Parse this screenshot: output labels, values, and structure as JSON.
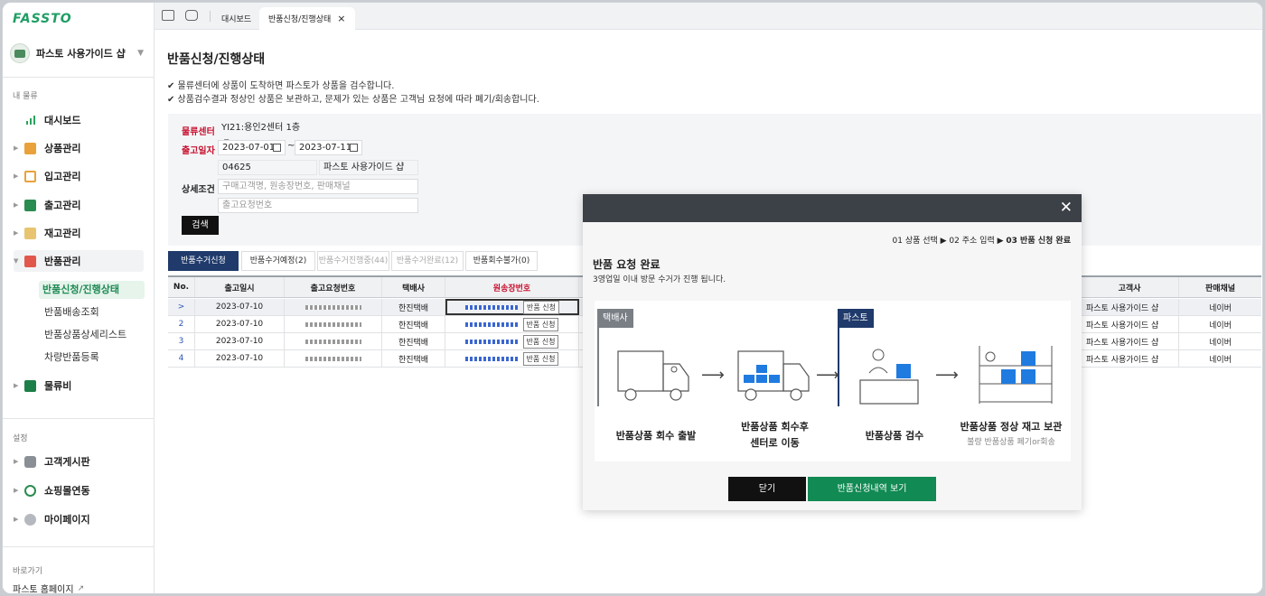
{
  "brand": {
    "logo": "FASSTO"
  },
  "shop": {
    "name": "파스토 사용가이드 샵"
  },
  "sidebar": {
    "group_my": "내 물류",
    "items": [
      {
        "label": "대시보드"
      },
      {
        "label": "상품관리"
      },
      {
        "label": "입고관리"
      },
      {
        "label": "출고관리"
      },
      {
        "label": "재고관리"
      },
      {
        "label": "반품관리"
      },
      {
        "label": "물류비"
      }
    ],
    "sub_items": [
      {
        "label": "반품신청/진행상태"
      },
      {
        "label": "반품배송조회"
      },
      {
        "label": "반품상품상세리스트"
      },
      {
        "label": "차량반품등록"
      }
    ],
    "group_settings": "설정",
    "settings_items": [
      {
        "label": "고객게시판"
      },
      {
        "label": "쇼핑몰연동"
      },
      {
        "label": "마이페이지"
      }
    ],
    "group_shortcuts": "바로가기",
    "shortcut_home": "파스토 홈페이지"
  },
  "tabs": [
    {
      "label": "대시보드"
    },
    {
      "label": "반품신청/진행상태",
      "close": "×"
    }
  ],
  "page": {
    "title": "반품신청/진행상태",
    "note1": "✔ 물류센터에 상품이 도착하면 파스토가 상품을 검수합니다.",
    "note2": "✔ 상품검수결과 정상인 상품은 보관하고, 문제가 있는 상품은 고객님 요청에 따라 폐기/회송합니다."
  },
  "filters": {
    "center_label": "물류센터",
    "center_value": "YI21:용인2센터 1층",
    "date_label": "출고일자",
    "date_from": "2023-07-01",
    "date_sep": "~",
    "date_to": "2023-07-11",
    "shop_code": "04625",
    "shop_name": "파스토 사용가이드 샵",
    "detail_label": "상세조건",
    "detail_placeholder": "구매고객명, 원송장번호, 판매채널",
    "order_placeholder": "출고요청번호",
    "search_label": "검색"
  },
  "grid_tabs": [
    {
      "label": "반품수거신청"
    },
    {
      "label": "반품수거예정(2)"
    },
    {
      "label": "반품수거진행중(44)"
    },
    {
      "label": "반품수거완료(12)"
    },
    {
      "label": "반품회수불가(0)"
    }
  ],
  "table": {
    "headers": {
      "no": "No.",
      "date": "출고일시",
      "order": "출고요청번호",
      "courier": "택배사",
      "invoice": "원송장번호",
      "customer": "고객사",
      "channel": "판매채널"
    },
    "rows": [
      {
        "no": ">",
        "date": "2023-07-10",
        "courier": "한진택배",
        "btn": "반품 신청",
        "customer": "파스토 사용가이드 샵",
        "channel": "네이버"
      },
      {
        "no": "2",
        "date": "2023-07-10",
        "courier": "한진택배",
        "btn": "반품 신청",
        "customer": "파스토 사용가이드 샵",
        "channel": "네이버"
      },
      {
        "no": "3",
        "date": "2023-07-10",
        "courier": "한진택배",
        "btn": "반품 신청",
        "customer": "파스토 사용가이드 샵",
        "channel": "네이버"
      },
      {
        "no": "4",
        "date": "2023-07-10",
        "courier": "한진택배",
        "btn": "반품 신청",
        "customer": "파스토 사용가이드 샵",
        "channel": "네이버"
      }
    ]
  },
  "modal": {
    "close": "✕",
    "steps_1": "01 상품 선택 ▶ 02 주소 입력 ▶",
    "steps_2": "03 반품 신청 완료",
    "title": "반품 요청 완료",
    "desc": "3영업일 이내 방문 수거가 진행 됩니다.",
    "flag_courier": "택배사",
    "flag_fassto": "파스토",
    "step1": "반품상품 회수 출발",
    "step2a": "반품상품 회수후",
    "step2b": "센터로 이동",
    "step3": "반품상품 검수",
    "step4": "반품상품 정상 재고 보관",
    "step4_sub": "불량 반품상품 폐기or회송",
    "close_btn": "닫기",
    "view_btn": "반품신청내역 보기"
  },
  "colors": {
    "accent": "#118a53",
    "required": "#c8102e",
    "tab_active": "#1f3a6b",
    "modal_header": "#3c4047"
  }
}
